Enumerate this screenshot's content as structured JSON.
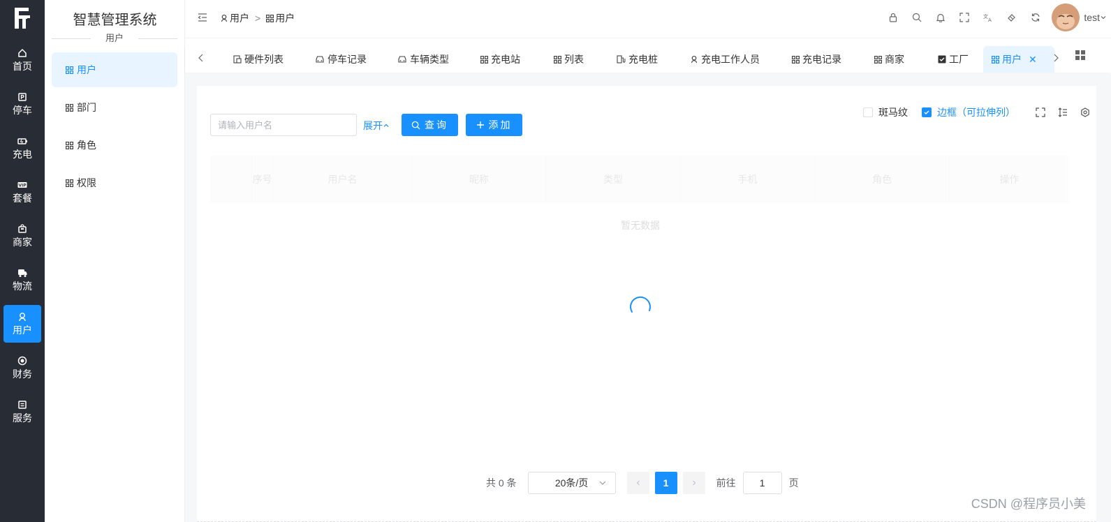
{
  "rail": {
    "items": [
      {
        "label": "首页",
        "icon": "home-icon"
      },
      {
        "label": "停车",
        "icon": "parking-icon"
      },
      {
        "label": "充电",
        "icon": "battery-icon"
      },
      {
        "label": "套餐",
        "icon": "vip-icon"
      },
      {
        "label": "商家",
        "icon": "shop-icon"
      },
      {
        "label": "物流",
        "icon": "truck-icon"
      },
      {
        "label": "用户",
        "icon": "user-icon",
        "active": true
      },
      {
        "label": "财务",
        "icon": "finance-icon"
      },
      {
        "label": "服务",
        "icon": "service-icon"
      }
    ]
  },
  "sidebar": {
    "system_title": "智慧管理系统",
    "section_title": "用户",
    "items": [
      {
        "label": "用户",
        "active": true
      },
      {
        "label": "部门"
      },
      {
        "label": "角色"
      },
      {
        "label": "权限"
      }
    ]
  },
  "header": {
    "breadcrumb": [
      "用户",
      "用户"
    ],
    "breadcrumb_sep": ">",
    "username": "test"
  },
  "tabs": [
    {
      "label": "硬件列表",
      "icon": "device-icon"
    },
    {
      "label": "停车记录",
      "icon": "car-icon"
    },
    {
      "label": "车辆类型",
      "icon": "car-icon"
    },
    {
      "label": "充电站",
      "icon": "grid-icon"
    },
    {
      "label": "列表",
      "icon": "grid-icon"
    },
    {
      "label": "充电桩",
      "icon": "charger-icon"
    },
    {
      "label": "充电工作人员",
      "icon": "user-icon"
    },
    {
      "label": "充电记录",
      "icon": "grid-icon"
    },
    {
      "label": "商家",
      "icon": "grid-icon"
    },
    {
      "label": "工厂",
      "icon": "checkbox-icon"
    },
    {
      "label": "用户",
      "icon": "grid-icon",
      "active": true
    }
  ],
  "toolbar": {
    "search_placeholder": "请输入用户名",
    "expand_label": "展开",
    "query_label": "查询",
    "add_label": "添加",
    "stripe_label": "斑马纹",
    "stripe_checked": false,
    "border_label": "边框（可拉伸列）",
    "border_checked": true
  },
  "table": {
    "columns": [
      "序号",
      "用户名",
      "昵称",
      "类型",
      "手机",
      "角色",
      "操作"
    ],
    "empty_text": "暂无数据"
  },
  "pagination": {
    "total_text": "共 0 条",
    "page_size": "20条/页",
    "current_page": "1",
    "goto_label": "前往",
    "goto_value": "1",
    "page_suffix": "页"
  },
  "watermark": "CSDN @程序员小美",
  "colors": {
    "primary": "#1890ff",
    "rail_bg": "#282c34"
  }
}
